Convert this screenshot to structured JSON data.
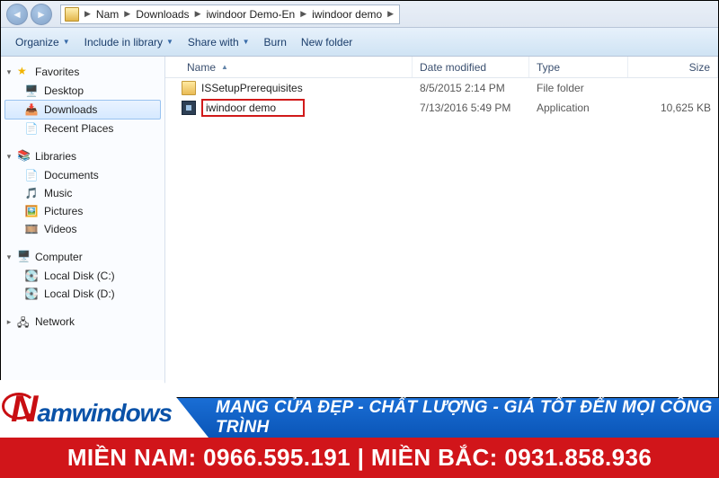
{
  "breadcrumb": {
    "root": "Nam",
    "lvl1": "Downloads",
    "lvl2": "iwindoor Demo-En",
    "lvl3": "iwindoor demo"
  },
  "toolbar": {
    "organize": "Organize",
    "include": "Include in library",
    "share": "Share with",
    "burn": "Burn",
    "newfolder": "New folder"
  },
  "columns": {
    "name": "Name",
    "date": "Date modified",
    "type": "Type",
    "size": "Size"
  },
  "nav": {
    "favorites": "Favorites",
    "desktop": "Desktop",
    "downloads": "Downloads",
    "recent": "Recent Places",
    "libraries": "Libraries",
    "documents": "Documents",
    "music": "Music",
    "pictures": "Pictures",
    "videos": "Videos",
    "computer": "Computer",
    "diskc": "Local Disk (C:)",
    "diskd": "Local Disk (D:)",
    "network": "Network"
  },
  "rows": [
    {
      "name": "ISSetupPrerequisites",
      "date": "8/5/2015 2:14 PM",
      "type": "File folder",
      "size": "",
      "kind": "folder",
      "hl": false
    },
    {
      "name": "iwindoor demo",
      "date": "7/13/2016 5:49 PM",
      "type": "Application",
      "size": "10,625 KB",
      "kind": "exe",
      "hl": true
    }
  ],
  "banner": {
    "logo_n": "N",
    "logo_rest": "amwindows",
    "slogan": "MANG CỬA ĐẸP - CHẤT LƯỢNG - GIÁ TỐT ĐẾN MỌI CÔNG TRÌNH",
    "phones": "MIỀN NAM: 0966.595.191 | MIỀN BẮC: 0931.858.936"
  }
}
